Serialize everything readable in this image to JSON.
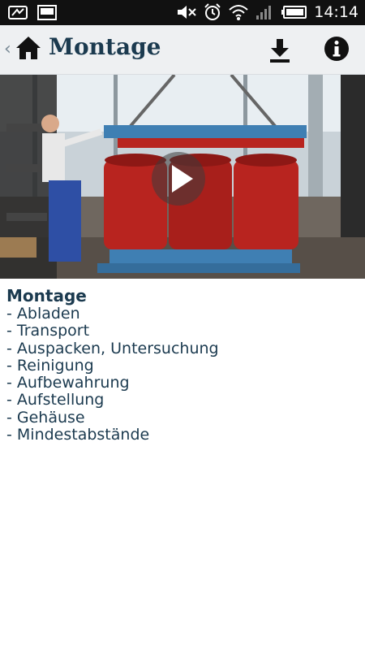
{
  "status_bar": {
    "time": "14:14",
    "icons": [
      "notification-icon",
      "gallery-icon",
      "mute-icon",
      "alarm-icon",
      "wifi-icon",
      "signal-icon",
      "battery-icon"
    ]
  },
  "app_bar": {
    "back_glyph": "‹",
    "title": "Montage",
    "icons": [
      "home-icon",
      "download-icon",
      "info-icon"
    ]
  },
  "video": {
    "play_icon": "play-icon"
  },
  "content": {
    "title": "Montage",
    "items": [
      "- Abladen",
      "- Transport",
      "- Auspacken, Untersuchung",
      "- Reinigung",
      "- Aufbewahrung",
      "- Aufstellung",
      "- Gehäuse",
      "- Mindestabstände"
    ]
  },
  "colors": {
    "status_bar_bg": "#111111",
    "app_bar_bg": "#eef0f2",
    "title_text": "#1b3a4f",
    "transformer_red": "#b8241f",
    "frame_blue": "#3f7fb3"
  }
}
